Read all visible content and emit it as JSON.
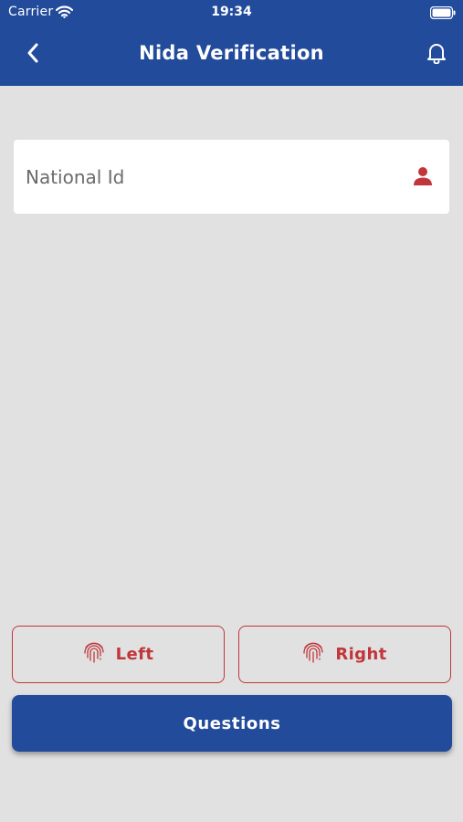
{
  "status_bar": {
    "carrier": "Carrier",
    "time": "19:34"
  },
  "nav": {
    "title": "Nida Verification",
    "back_icon": "chevron-left-icon",
    "bell_icon": "bell-icon"
  },
  "form": {
    "national_id": {
      "placeholder": "National Id",
      "value": "",
      "icon": "person-icon"
    }
  },
  "buttons": {
    "left_label": "Left",
    "right_label": "Right",
    "questions_label": "Questions",
    "fingerprint_icon": "fingerprint-icon"
  },
  "colors": {
    "primary": "#234b9b",
    "accent": "#c0363a",
    "background": "#e1e1e1",
    "card": "#ffffff"
  }
}
